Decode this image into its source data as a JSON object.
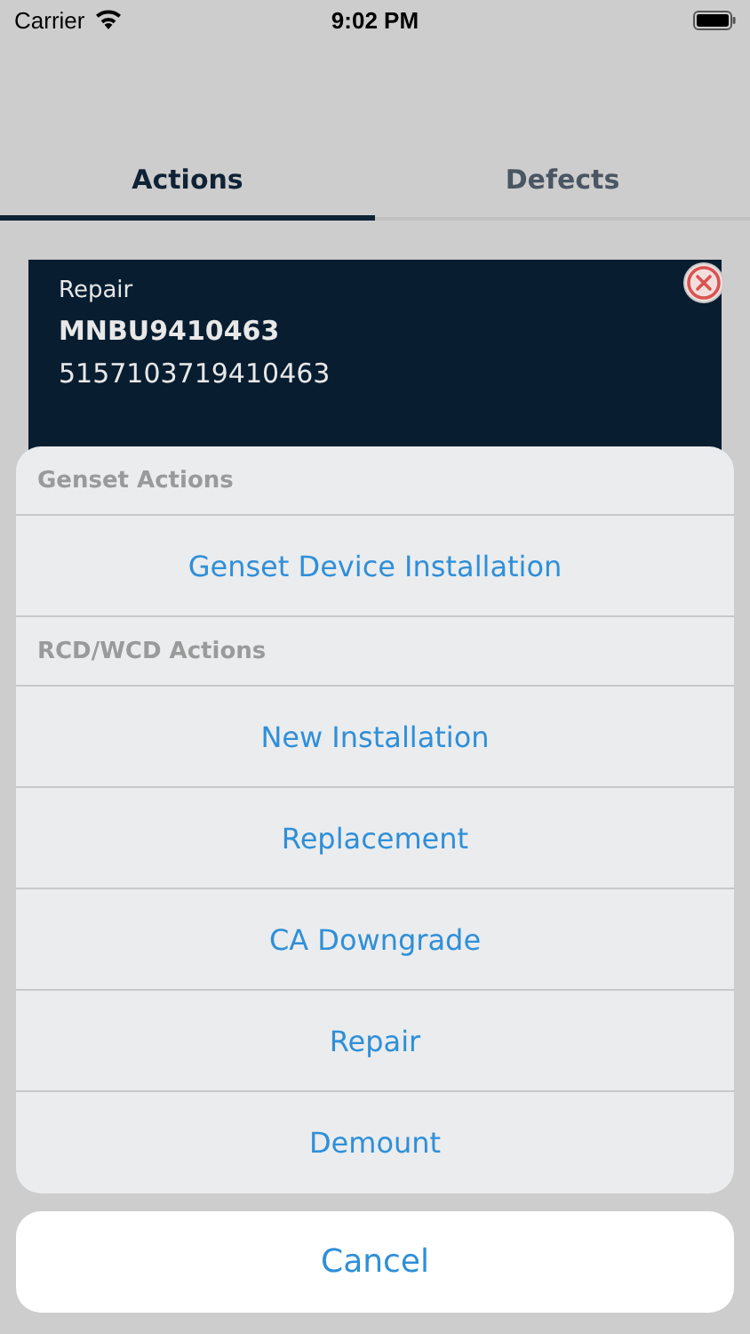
{
  "status_bar": {
    "carrier": "Carrier",
    "time": "9:02 PM"
  },
  "tabs": [
    {
      "label": "Actions",
      "selected": true
    },
    {
      "label": "Defects",
      "selected": false
    }
  ],
  "card": {
    "type": "Repair",
    "container": "MNBU9410463",
    "number": "5157103719410463"
  },
  "action_sheet": {
    "sections": [
      {
        "title": "Genset Actions",
        "actions": [
          "Genset Device Installation"
        ]
      },
      {
        "title": "RCD/WCD Actions",
        "actions": [
          "New Installation",
          "Replacement",
          "CA Downgrade",
          "Repair",
          "Demount"
        ]
      }
    ],
    "cancel": "Cancel"
  }
}
